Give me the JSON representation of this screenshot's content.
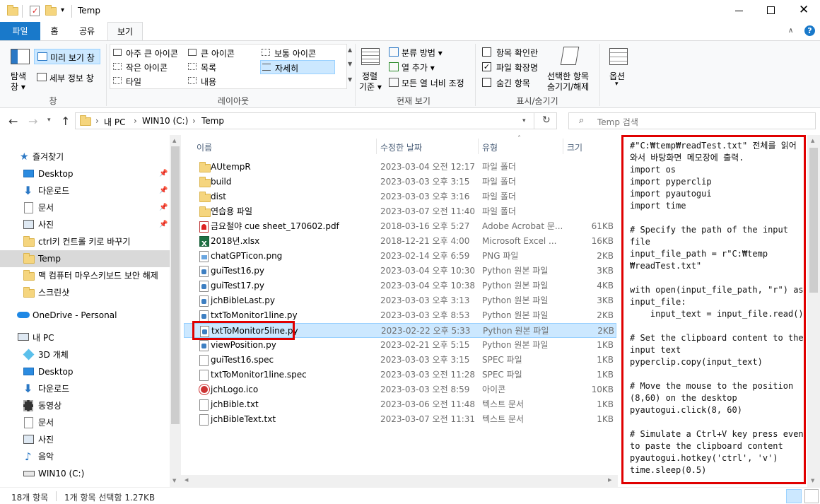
{
  "window": {
    "title": "Temp"
  },
  "ribbon_tabs": [
    "파일",
    "홈",
    "공유",
    "보기"
  ],
  "ribbon": {
    "pane": {
      "nav_pane": "탐색",
      "nav_pane2": "창",
      "preview": "미리 보기 창",
      "details": "세부 정보 창",
      "group": "창"
    },
    "layout": {
      "items": [
        "아주 큰 아이콘",
        "큰 아이콘",
        "보통 아이콘",
        "작은 아이콘",
        "목록",
        "자세히",
        "타일",
        "내용"
      ],
      "group": "레이아웃"
    },
    "current_view": {
      "sort_by": "정렬",
      "sort_by2": "기준",
      "group_by": "분류 방법",
      "add_columns": "열 추가",
      "size_all_columns": "모든 열 너비 조정",
      "group": "현재 보기"
    },
    "show_hide": {
      "item_checkboxes": "항목 확인란",
      "file_extensions": "파일 확장명",
      "hidden_items": "숨긴 항목",
      "hide_selected": "선택한 항목",
      "hide_selected2": "숨기기/해제",
      "group": "표시/숨기기"
    },
    "options": {
      "label": "옵션"
    }
  },
  "address": {
    "crumbs": [
      "내 PC",
      "WIN10 (C:)",
      "Temp"
    ],
    "search_placeholder": "Temp 검색"
  },
  "nav": {
    "quick_access": "즐겨찾기",
    "quick_items": [
      "Desktop",
      "다운로드",
      "문서",
      "사진",
      "ctrl키 컨트롤 키로 바꾸기",
      "Temp",
      "맥 컴퓨터 마우스키보드 보안 해제",
      "스크린샷"
    ],
    "onedrive": "OneDrive - Personal",
    "this_pc": "내 PC",
    "pc_items": [
      "3D 개체",
      "Desktop",
      "다운로드",
      "동영상",
      "문서",
      "사진",
      "음악",
      "WIN10 (C:)"
    ]
  },
  "columns": {
    "name": "이름",
    "date": "수정한 날짜",
    "type": "유형",
    "size": "크기"
  },
  "files": [
    {
      "name": "AUtempR",
      "date": "2023-03-04 오전 12:17",
      "type": "파일 폴더",
      "size": "",
      "icon": "folder-icon"
    },
    {
      "name": "build",
      "date": "2023-03-03 오후 3:15",
      "type": "파일 폴더",
      "size": "",
      "icon": "folder-icon"
    },
    {
      "name": "dist",
      "date": "2023-03-03 오후 3:16",
      "type": "파일 폴더",
      "size": "",
      "icon": "folder-icon"
    },
    {
      "name": "연습용 파일",
      "date": "2023-03-07 오전 11:40",
      "type": "파일 폴더",
      "size": "",
      "icon": "folder-icon"
    },
    {
      "name": "금요철야 cue sheet_170602.pdf",
      "date": "2018-03-16 오후 5:27",
      "type": "Adobe Acrobat 문...",
      "size": "61KB",
      "icon": "pdf-file-icon"
    },
    {
      "name": "2018년.xlsx",
      "date": "2018-12-21 오후 4:00",
      "type": "Microsoft Excel ...",
      "size": "16KB",
      "icon": "excel-file-icon"
    },
    {
      "name": "chatGPTicon.png",
      "date": "2023-02-14 오후 6:59",
      "type": "PNG 파일",
      "size": "2KB",
      "icon": "png-file-icon"
    },
    {
      "name": "guiTest16.py",
      "date": "2023-03-04 오후 10:30",
      "type": "Python 원본 파일",
      "size": "3KB",
      "icon": "python-file-icon"
    },
    {
      "name": "guiTest17.py",
      "date": "2023-03-04 오후 10:38",
      "type": "Python 원본 파일",
      "size": "4KB",
      "icon": "python-file-icon"
    },
    {
      "name": "jchBibleLast.py",
      "date": "2023-03-03 오후 3:13",
      "type": "Python 원본 파일",
      "size": "3KB",
      "icon": "python-file-icon"
    },
    {
      "name": "txtToMonitor1line.py",
      "date": "2023-03-03 오후 8:53",
      "type": "Python 원본 파일",
      "size": "2KB",
      "icon": "python-file-icon"
    },
    {
      "name": "txtToMonitor5line.py",
      "date": "2023-02-22 오후 5:33",
      "type": "Python 원본 파일",
      "size": "2KB",
      "icon": "python-file-icon"
    },
    {
      "name": "viewPosition.py",
      "date": "2023-02-21 오후 5:15",
      "type": "Python 원본 파일",
      "size": "1KB",
      "icon": "python-file-icon"
    },
    {
      "name": "guiTest16.spec",
      "date": "2023-03-03 오후 3:15",
      "type": "SPEC 파일",
      "size": "1KB",
      "icon": "doc-file-icon"
    },
    {
      "name": "txtToMonitor1line.spec",
      "date": "2023-03-03 오전 11:28",
      "type": "SPEC 파일",
      "size": "1KB",
      "icon": "doc-file-icon"
    },
    {
      "name": "jchLogo.ico",
      "date": "2023-03-03 오전 8:59",
      "type": "아이콘",
      "size": "10KB",
      "icon": "ico-file-icon"
    },
    {
      "name": "jchBible.txt",
      "date": "2023-03-06 오전 11:48",
      "type": "텍스트 문서",
      "size": "1KB",
      "icon": "doc-file-icon"
    },
    {
      "name": "jchBibleText.txt",
      "date": "2023-03-07 오전 11:31",
      "type": "텍스트 문서",
      "size": "1KB",
      "icon": "doc-file-icon"
    }
  ],
  "selected_index": 11,
  "preview": {
    "code": "#\"C:₩temp₩readTest.txt\" 전체를 읽어\n와서 바탕화면 메모장에 출력.\nimport os\nimport pyperclip\nimport pyautogui\nimport time\n\n# Specify the path of the input\nfile\ninput_file_path = r\"C:₩temp\n₩readTest.txt\"\n\nwith open(input_file_path, \"r\") as\ninput_file:\n    input_text = input_file.read()\n\n# Set the clipboard content to the\ninput text\npyperclip.copy(input_text)\n\n# Move the mouse to the position\n(8,60) on the desktop\npyautogui.click(8, 60)\n\n# Simulate a Ctrl+V key press event\nto paste the clipboard content\npyautogui.hotkey('ctrl', 'v')\ntime.sleep(0.5)"
  },
  "status": {
    "count": "18개 항목",
    "selection": "1개 항목 선택함 1.27KB"
  },
  "colors": {
    "file_tab": "#1979ca",
    "selection": "#cce8ff",
    "highlight_border": "#e00000",
    "link": "#1a5aa0"
  }
}
